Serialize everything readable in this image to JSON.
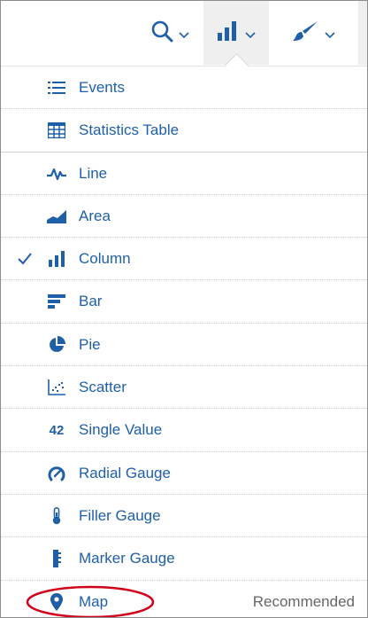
{
  "toolbar": {
    "buttons": [
      {
        "icon": "search-icon"
      },
      {
        "icon": "column-chart-icon",
        "selected": true
      },
      {
        "icon": "paintbrush-icon"
      }
    ]
  },
  "menu": {
    "items": [
      {
        "label": "Events",
        "icon": "list-icon"
      },
      {
        "label": "Statistics Table",
        "icon": "table-icon"
      },
      {
        "label": "Line",
        "icon": "line-chart-icon"
      },
      {
        "label": "Area",
        "icon": "area-chart-icon"
      },
      {
        "label": "Column",
        "icon": "column-chart-icon",
        "checked": true
      },
      {
        "label": "Bar",
        "icon": "bar-chart-icon"
      },
      {
        "label": "Pie",
        "icon": "pie-chart-icon"
      },
      {
        "label": "Scatter",
        "icon": "scatter-chart-icon"
      },
      {
        "label": "Single Value",
        "icon_text": "42"
      },
      {
        "label": "Radial Gauge",
        "icon": "radial-gauge-icon"
      },
      {
        "label": "Filler Gauge",
        "icon": "filler-gauge-icon"
      },
      {
        "label": "Marker Gauge",
        "icon": "marker-gauge-icon"
      },
      {
        "label": "Map",
        "icon": "map-pin-icon",
        "badge": "Recommended",
        "highlighted": true
      }
    ]
  },
  "colors": {
    "accent": "#1f5fa8",
    "muted_text": "#666666",
    "highlight": "#d0021b"
  }
}
